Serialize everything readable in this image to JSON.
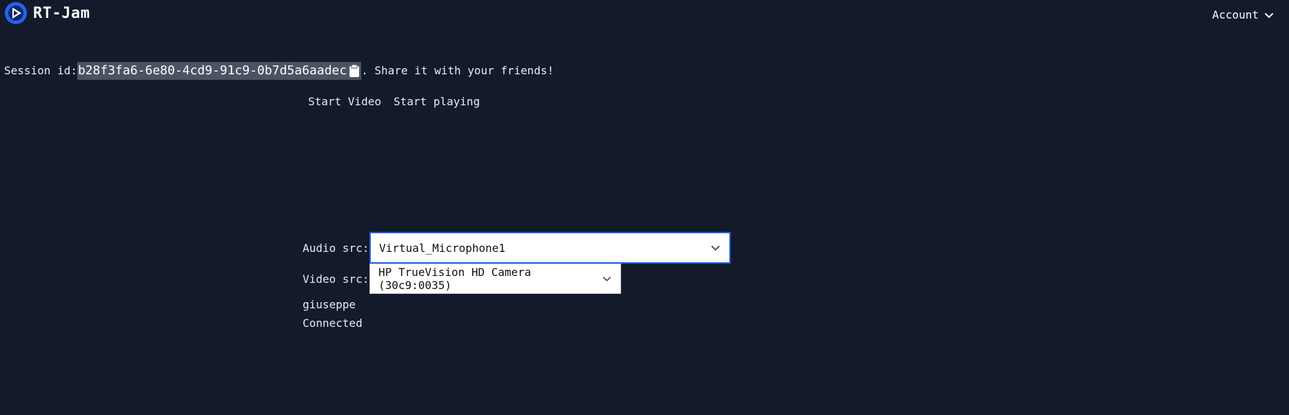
{
  "header": {
    "app_title": "RT-Jam",
    "account_label": "Account",
    "icons": {
      "logo": "logo-icon",
      "account_menu": "chevron-down-icon"
    }
  },
  "session": {
    "prefix": "Session id:",
    "id": "b28f3fa6-6e80-4cd9-91c9-0b7d5a6aadec",
    "suffix": ". Share it with your friends!",
    "copy_icon": "clipboard-icon"
  },
  "controls": {
    "start_video": "Start Video",
    "start_playing": "Start playing"
  },
  "form": {
    "audio_label": "Audio src:",
    "audio_value": "Virtual_Microphone1",
    "video_label": "Video src:",
    "video_value": "HP TrueVision HD Camera (30c9:0035)"
  },
  "user": {
    "name": "giuseppe",
    "status": "Connected"
  },
  "colors": {
    "background": "#121a2b",
    "logo_blue": "#2563eb",
    "focus_border": "#2563eb",
    "highlight": "#4b5362"
  }
}
